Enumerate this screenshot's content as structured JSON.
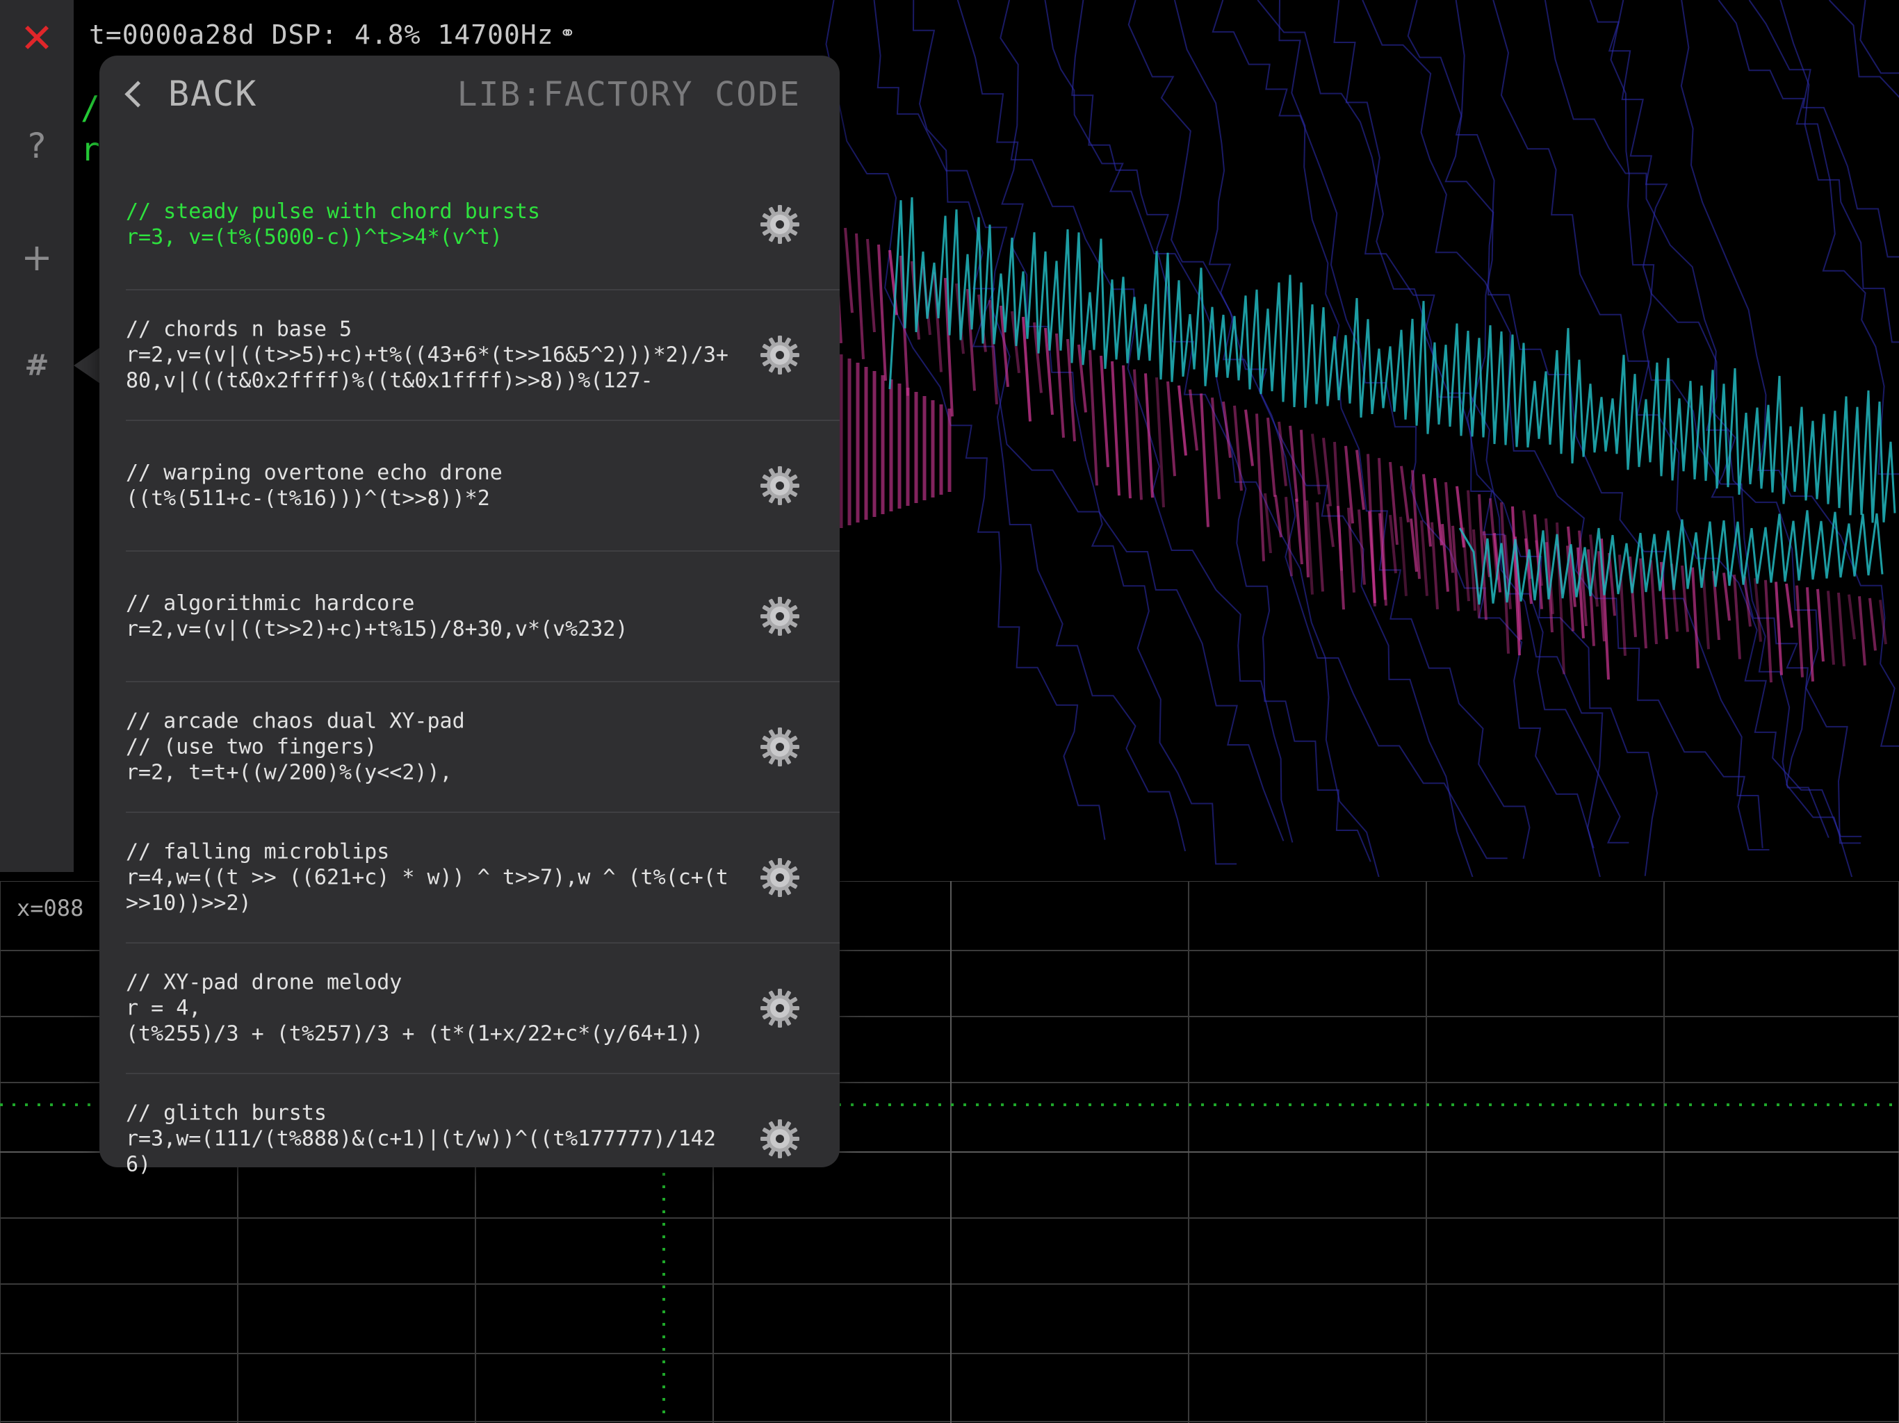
{
  "status": {
    "text": "t=0000a28d DSP: 4.8% 14700Hz",
    "link_icon": "link-icon"
  },
  "toolbar": {
    "close_icon": "✕",
    "help_icon": "?",
    "add_icon": "+",
    "hash_icon": "#"
  },
  "background_code": {
    "line1": "/",
    "line2": "r"
  },
  "scope": {
    "x_readout": "x=088"
  },
  "panel": {
    "back_label": "BACK",
    "title": "LIB:FACTORY CODE",
    "entries": [
      {
        "code": "// steady pulse with chord bursts\nr=3, v=(t%(5000-c))^t>>4*(v^t)",
        "active": true
      },
      {
        "code": "// chords n base 5\nr=2,v=(v|((t>>5)+c)+t%((43+6*(t>>16&5^2)))*2)/3+80,v|(((t&0x2ffff)%((t&0x1ffff)>>8))%(127-",
        "active": false
      },
      {
        "code": "// warping overtone echo drone\n((t%(511+c-(t%16)))^(t>>8))*2",
        "active": false
      },
      {
        "code": "// algorithmic hardcore\nr=2,v=(v|((t>>2)+c)+t%15)/8+30,v*(v%232)",
        "active": false
      },
      {
        "code": "// arcade chaos dual XY-pad\n// (use two fingers)\nr=2, t=t+((w/200)%(y<<2)),",
        "active": false
      },
      {
        "code": "// falling microblips\nr=4,w=((t >> ((621+c) * w)) ^ t>>7),w ^ (t%(c+(t>>10))>>2)",
        "active": false
      },
      {
        "code": "// XY-pad drone melody\nr = 4,\n(t%255)/3 + (t%257)/3 + (t*(1+x/22+c*(y/64+1))",
        "active": false
      },
      {
        "code": "// glitch bursts\nr=3,w=(111/(t%888)&(c+1)|(t/w))^((t%177777)/1426)",
        "active": false
      }
    ]
  },
  "colors": {
    "accent_green": "#2ee23e",
    "close_red": "#e0262a",
    "panel_bg": "#2f2f31",
    "viz_blue": "#3a3ad0",
    "viz_pink": "#d93a9c",
    "viz_cyan": "#22b9c0"
  }
}
